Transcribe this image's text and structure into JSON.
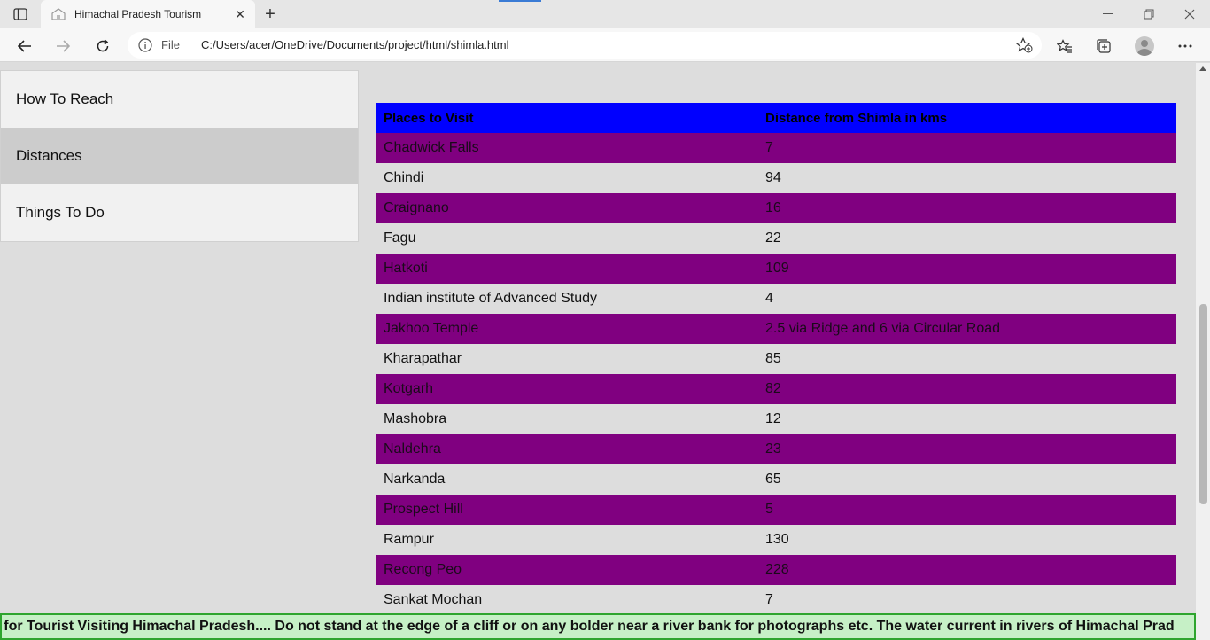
{
  "browser": {
    "tab_title": "Himachal Pradesh Tourism",
    "file_label": "File",
    "url": "C:/Users/acer/OneDrive/Documents/project/html/shimla.html"
  },
  "sidebar": {
    "items": [
      {
        "label": "How To Reach"
      },
      {
        "label": "Distances"
      },
      {
        "label": "Things To Do"
      }
    ]
  },
  "table": {
    "headers": [
      "Places to Visit",
      "Distance from Shimla in kms"
    ],
    "rows": [
      [
        "Chadwick Falls",
        "7"
      ],
      [
        "Chindi",
        "94"
      ],
      [
        "Craignano",
        "16"
      ],
      [
        "Fagu",
        "22"
      ],
      [
        "Hatkoti",
        "109"
      ],
      [
        "Indian institute of Advanced Study",
        "4"
      ],
      [
        "Jakhoo Temple",
        "2.5 via Ridge and 6 via Circular Road"
      ],
      [
        "Kharapathar",
        "85"
      ],
      [
        "Kotgarh",
        "82"
      ],
      [
        "Mashobra",
        "12"
      ],
      [
        "Naldehra",
        "23"
      ],
      [
        "Narkanda",
        "65"
      ],
      [
        "Prospect Hill",
        "5"
      ],
      [
        "Rampur",
        "130"
      ],
      [
        "Recong Peo",
        "228"
      ],
      [
        "Sankat Mochan",
        "7"
      ]
    ]
  },
  "marquee": {
    "text": "es for Tourist Visiting Himachal Pradesh.... Do not stand at the edge of a cliff or on any bolder near a river bank for photographs etc. The water current in rivers of Himachal Prad"
  },
  "colors": {
    "header_bg": "#0000ff",
    "alt_row_bg": "#800080",
    "marquee_bg": "#c6f0c6",
    "marquee_border": "#2ea52e"
  }
}
